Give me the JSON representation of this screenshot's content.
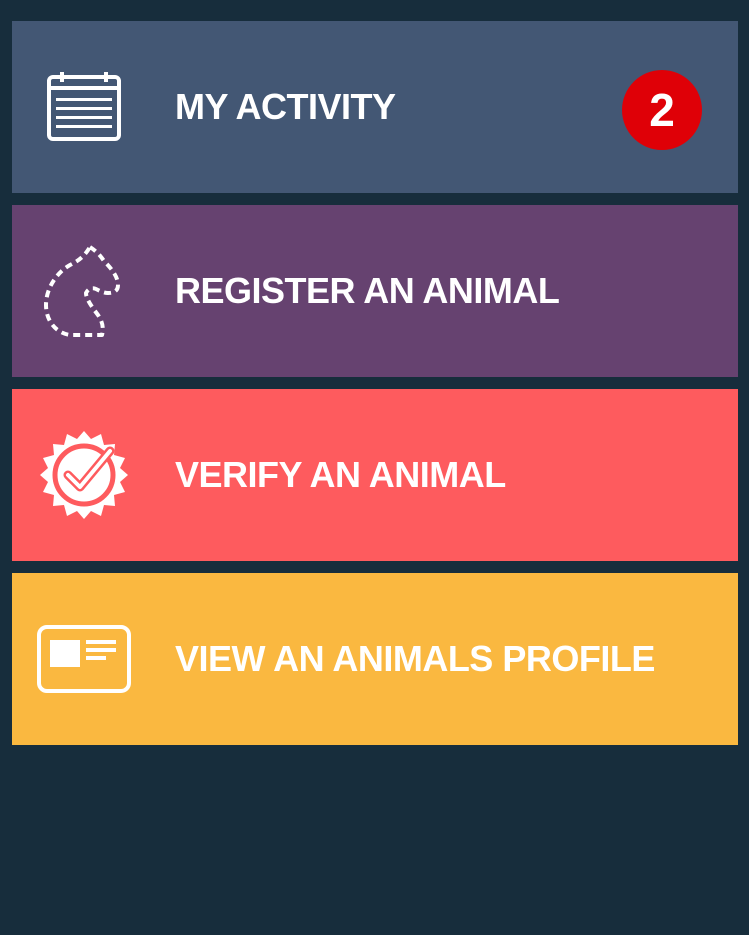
{
  "colors": {
    "background": "#172d3c",
    "activity": "#435774",
    "register": "#664270",
    "verify": "#fe5b5e",
    "profile": "#fab840",
    "badge": "#df0007"
  },
  "menu": {
    "items": [
      {
        "id": "activity",
        "label": "MY ACTIVITY",
        "icon": "calendar-icon",
        "color": "#435774",
        "badge": "2"
      },
      {
        "id": "register",
        "label": "REGISTER AN ANIMAL",
        "icon": "horse-head-icon",
        "color": "#664270"
      },
      {
        "id": "verify",
        "label": "VERIFY AN ANIMAL",
        "icon": "verified-badge-icon",
        "color": "#fe5b5e"
      },
      {
        "id": "profile",
        "label": "VIEW AN ANIMALS PROFILE",
        "icon": "id-card-icon",
        "color": "#fab840"
      }
    ]
  }
}
